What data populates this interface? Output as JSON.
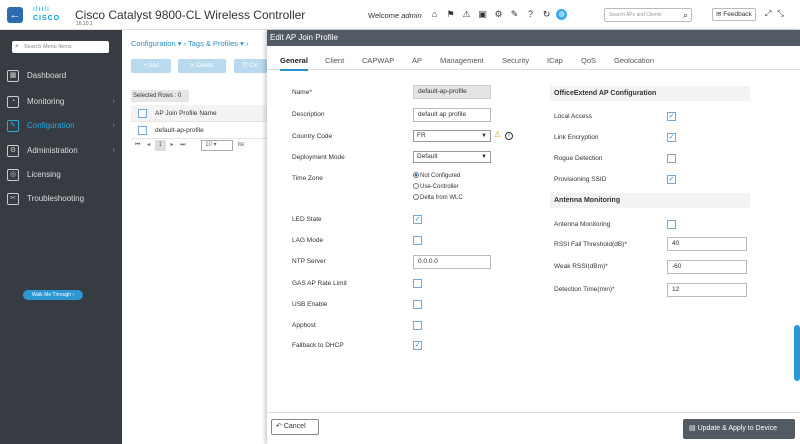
{
  "topbar": {
    "logo_text": "CISCO",
    "title": "Cisco Catalyst 9800-CL Wireless Controller",
    "version": "16.10.1",
    "welcome_prefix": "Welcome",
    "username": "admin",
    "search_placeholder": "Search APs and Clients",
    "feedback_label": "Feedback"
  },
  "sidebar": {
    "search_placeholder": "Search Menu Items",
    "items": [
      {
        "label": "Dashboard",
        "icon": "dashboard-icon"
      },
      {
        "label": "Monitoring",
        "icon": "monitoring-icon"
      },
      {
        "label": "Configuration",
        "icon": "wrench-icon",
        "active": true
      },
      {
        "label": "Administration",
        "icon": "gear-icon"
      },
      {
        "label": "Licensing",
        "icon": "license-icon"
      },
      {
        "label": "Troubleshooting",
        "icon": "tools-icon"
      }
    ],
    "walk_me_label": "Walk Me Through ›"
  },
  "main": {
    "breadcrumb": "Configuration ▾  ›  Tags & Profiles ▾  ›",
    "add_label": "+ Add",
    "delete_label": "✕ Delete",
    "clone_label": "⎘ Clo",
    "selected_rows": "Selected Rows : 0",
    "table_header": "AP Join Profile Name",
    "rows": [
      "default-ap-profile"
    ],
    "page_number": "1",
    "page_size": "10",
    "items_suffix": "ite"
  },
  "modal": {
    "title": "Edit AP Join Profile",
    "tabs": [
      "General",
      "Client",
      "CAPWAP",
      "AP",
      "Management",
      "Security",
      "ICap",
      "QoS",
      "Geolocation"
    ],
    "active_tab": "General",
    "fields": {
      "name_label": "Name*",
      "name_value": "default-ap-profile",
      "description_label": "Description",
      "description_value": "default ap profile",
      "country_label": "Country Code",
      "country_value": "FR",
      "deployment_label": "Deployment Mode",
      "deployment_value": "Default",
      "timezone_label": "Time Zone",
      "tz_opt1": "Not Configured",
      "tz_opt2": "Use-Controller",
      "tz_opt3": "Delta from WLC",
      "led_label": "LED State",
      "lag_label": "LAG Mode",
      "ntp_label": "NTP Server",
      "ntp_value": "0.0.0.0",
      "gas_label": "GAS AP Rate Limit",
      "usb_label": "USB Enable",
      "apphost_label": "Apphost",
      "dhcp_label": "Fallback to DHCP"
    },
    "officeextend": {
      "title": "OfficeExtend AP Configuration",
      "local_access": "Local Access",
      "link_encryption": "Link Encryption",
      "rogue_detection": "Rogue Detection",
      "provisioning_ssid": "Provisioning SSID"
    },
    "antenna": {
      "title": "Antenna Monitoring",
      "monitoring_label": "Antenna Monitoring",
      "rssi_fail_label": "RSSI Fail Threshold(dB)*",
      "rssi_fail_value": "40",
      "weak_rssi_label": "Weak RSSI(dBm)*",
      "weak_rssi_value": "-60",
      "detection_label": "Detection Time(min)*",
      "detection_value": "12"
    },
    "cancel_label": "Cancel",
    "apply_label": "Update & Apply to Device"
  }
}
